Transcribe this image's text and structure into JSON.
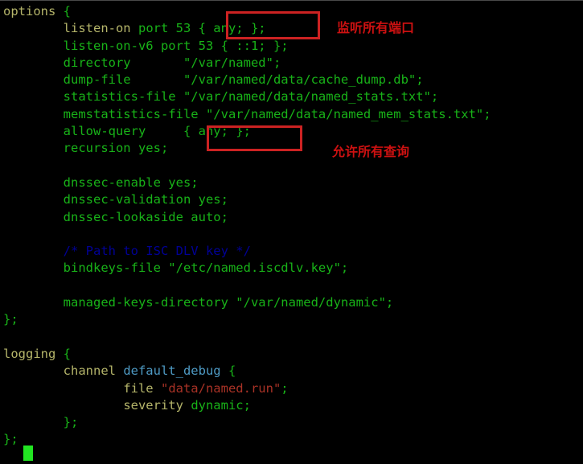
{
  "terminal": {
    "background_color": "#000000",
    "default_text_color": "#18b218",
    "keyword_color": "#b5b56a",
    "comment_color": "#000096",
    "identifier_color": "#4e9ac4",
    "string_color": "#a93226",
    "cursor_color": "#22e522",
    "annotation_color": "#cc1111",
    "highlight_box_color": "#cc2222"
  },
  "code": {
    "lines": [
      {
        "indent": "",
        "segments": [
          {
            "text": "options",
            "style": "k"
          },
          {
            "text": " {",
            "style": "g"
          }
        ]
      },
      {
        "indent": "        ",
        "segments": [
          {
            "text": "listen-on",
            "style": "k"
          },
          {
            "text": " port 53 { any; };",
            "style": "g"
          }
        ]
      },
      {
        "indent": "        ",
        "segments": [
          {
            "text": "listen-on-v6 port 53 { ::1; };",
            "style": "g"
          }
        ]
      },
      {
        "indent": "        ",
        "segments": [
          {
            "text": "directory       \"/var/named\";",
            "style": "g"
          }
        ]
      },
      {
        "indent": "        ",
        "segments": [
          {
            "text": "dump-file       \"/var/named/data/cache_dump.db\";",
            "style": "g"
          }
        ]
      },
      {
        "indent": "        ",
        "segments": [
          {
            "text": "statistics-file \"/var/named/data/named_stats.txt\";",
            "style": "g"
          }
        ]
      },
      {
        "indent": "        ",
        "segments": [
          {
            "text": "memstatistics-file \"/var/named/data/named_mem_stats.txt\";",
            "style": "g"
          }
        ]
      },
      {
        "indent": "        ",
        "segments": [
          {
            "text": "allow-query     { any; };",
            "style": "g"
          }
        ]
      },
      {
        "indent": "        ",
        "segments": [
          {
            "text": "recursion yes;",
            "style": "g"
          }
        ]
      },
      {
        "indent": "",
        "segments": [
          {
            "text": "",
            "style": "g"
          }
        ]
      },
      {
        "indent": "        ",
        "segments": [
          {
            "text": "dnssec-enable yes;",
            "style": "g"
          }
        ]
      },
      {
        "indent": "        ",
        "segments": [
          {
            "text": "dnssec-validation yes;",
            "style": "g"
          }
        ]
      },
      {
        "indent": "        ",
        "segments": [
          {
            "text": "dnssec-lookaside auto;",
            "style": "g"
          }
        ]
      },
      {
        "indent": "",
        "segments": [
          {
            "text": "",
            "style": "g"
          }
        ]
      },
      {
        "indent": "        ",
        "segments": [
          {
            "text": "/* Path to ISC DLV key */",
            "style": "cm"
          }
        ]
      },
      {
        "indent": "        ",
        "segments": [
          {
            "text": "bindkeys-file \"/etc/named.iscdlv.key\";",
            "style": "g"
          }
        ]
      },
      {
        "indent": "",
        "segments": [
          {
            "text": "",
            "style": "g"
          }
        ]
      },
      {
        "indent": "        ",
        "segments": [
          {
            "text": "managed-keys-directory \"/var/named/dynamic\";",
            "style": "g"
          }
        ]
      },
      {
        "indent": "",
        "segments": [
          {
            "text": "};",
            "style": "g"
          }
        ]
      },
      {
        "indent": "",
        "segments": [
          {
            "text": "",
            "style": "g"
          }
        ]
      },
      {
        "indent": "",
        "segments": [
          {
            "text": "logging",
            "style": "k"
          },
          {
            "text": " {",
            "style": "g"
          }
        ]
      },
      {
        "indent": "        ",
        "segments": [
          {
            "text": "channel ",
            "style": "k"
          },
          {
            "text": "default_debug",
            "style": "id"
          },
          {
            "text": " {",
            "style": "g"
          }
        ]
      },
      {
        "indent": "                ",
        "segments": [
          {
            "text": "file ",
            "style": "k"
          },
          {
            "text": "\"data/named.run\"",
            "style": "st"
          },
          {
            "text": ";",
            "style": "g"
          }
        ]
      },
      {
        "indent": "                ",
        "segments": [
          {
            "text": "severity ",
            "style": "k"
          },
          {
            "text": "dynamic;",
            "style": "g"
          }
        ]
      },
      {
        "indent": "        ",
        "segments": [
          {
            "text": "};",
            "style": "g"
          }
        ]
      },
      {
        "indent": "",
        "segments": [
          {
            "text": "};",
            "style": "g"
          }
        ]
      }
    ]
  },
  "annotations": [
    {
      "id": "ann-listen",
      "text": "监听所有端口"
    },
    {
      "id": "ann-query",
      "text": "允许所有查询"
    }
  ],
  "highlight_boxes": [
    {
      "id": "box-listen-on",
      "target_text": "{ any; };"
    },
    {
      "id": "box-allow-query",
      "target_text": "{ any; };"
    }
  ]
}
